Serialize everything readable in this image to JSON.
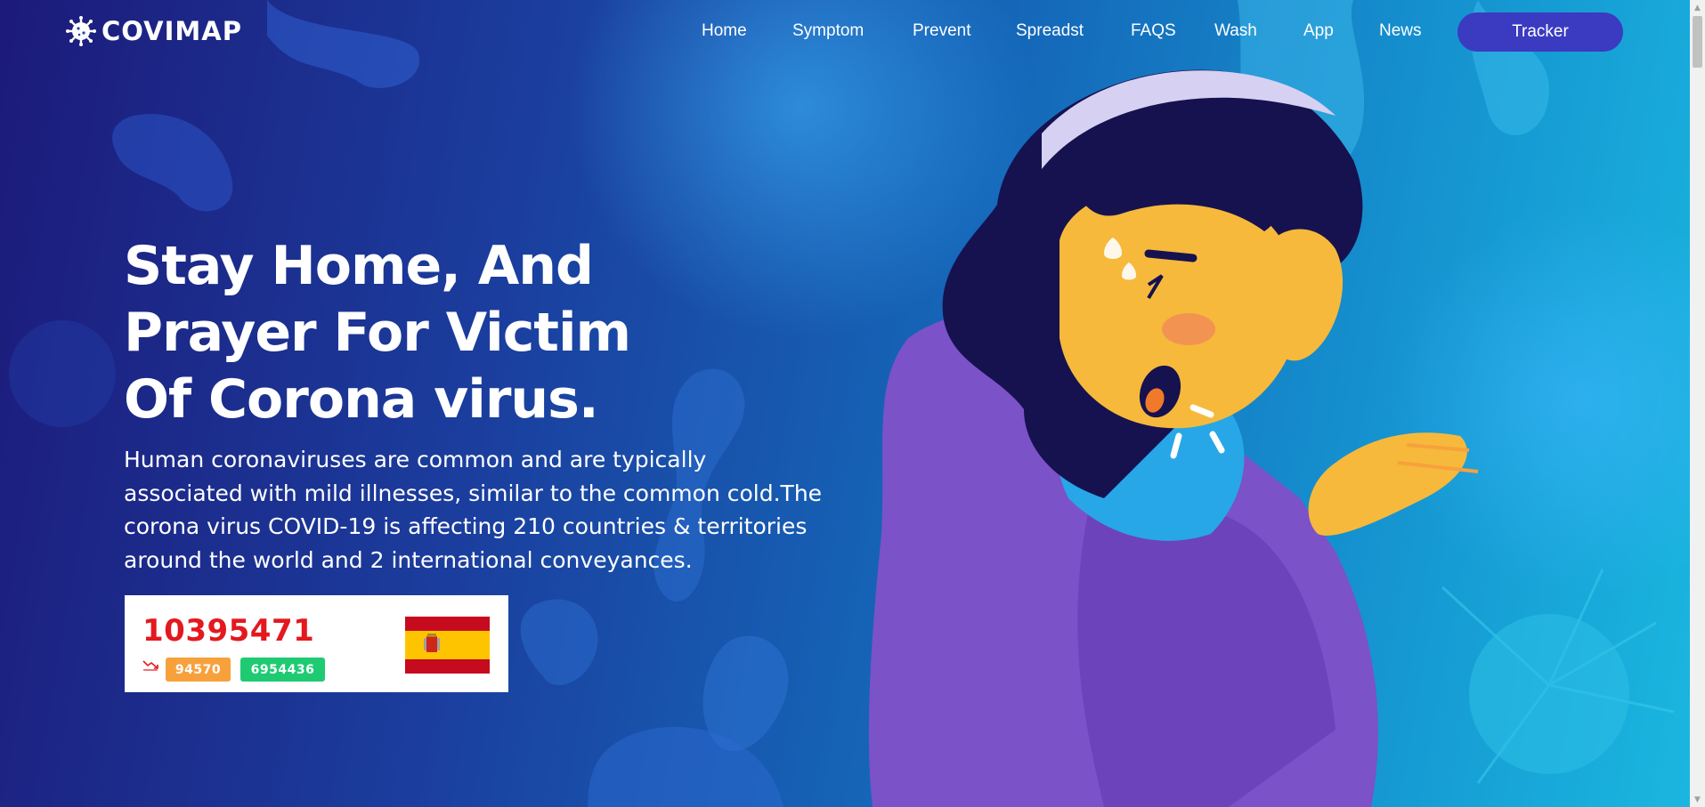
{
  "brand": {
    "name": "COVIMAP",
    "icon": "virus-icon"
  },
  "nav": {
    "items": [
      "Home",
      "Symptom",
      "Prevent",
      "Spreadst",
      "FAQS",
      "Wash",
      "App",
      "News"
    ],
    "cta": "Tracker"
  },
  "hero": {
    "headline_lines": [
      "Stay Home, And",
      "Prayer For Victim",
      "Of Corona virus."
    ],
    "description_lines": [
      "Human coronaviruses are common and are typically",
      "associated with mild illnesses, similar to the common cold.The",
      "corona virus COVID-19 is affecting 210 countries & territories",
      "around the world and 2 international conveyances."
    ]
  },
  "stats_card": {
    "total": "10395471",
    "deaths": "94570",
    "recovered": "6954436",
    "trend_icon": "trend-down-icon",
    "flag": "spain-flag"
  },
  "colors": {
    "total_red": "#e3191f",
    "deaths_orange": "#f7a13c",
    "recovered_green": "#1ecb73",
    "cta_bg": "#3a3bc0"
  }
}
